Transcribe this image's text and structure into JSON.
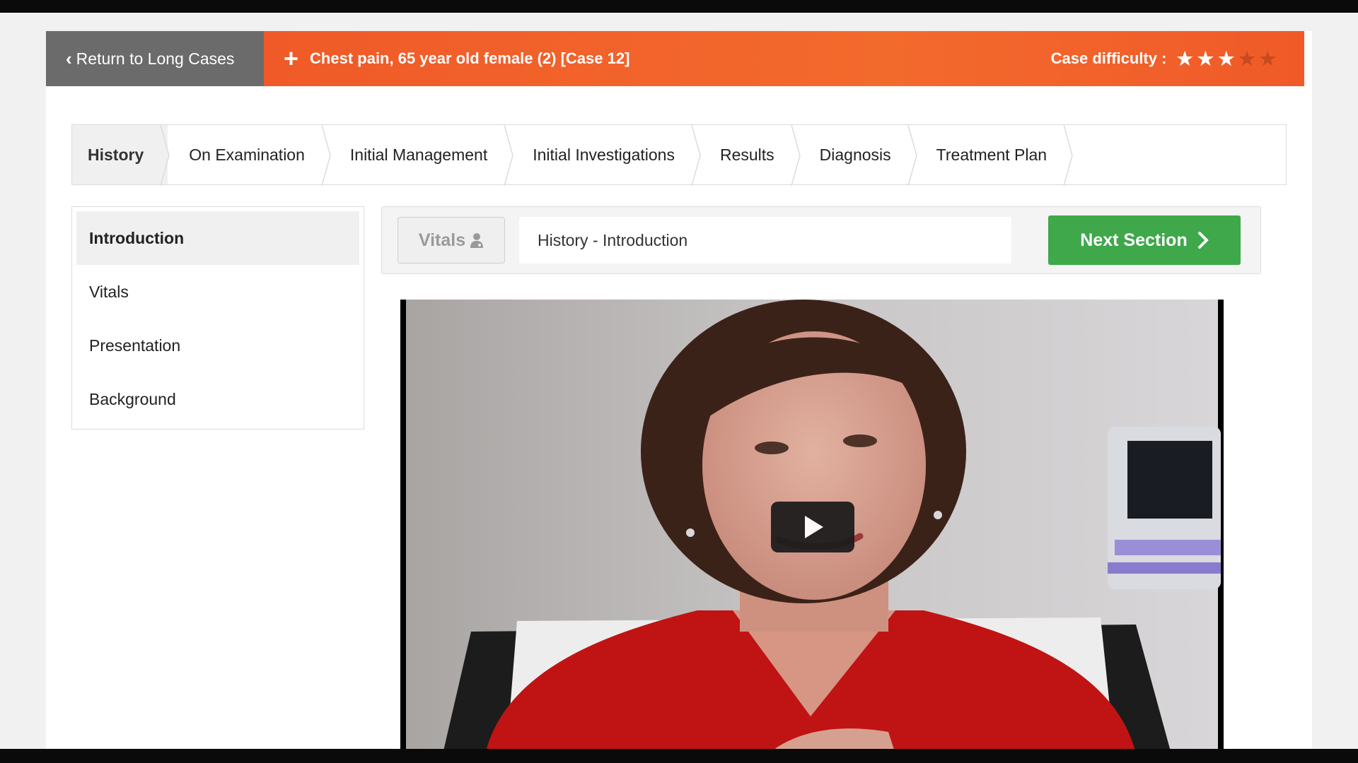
{
  "header": {
    "back_label": "Return to Long Cases",
    "case_title": "Chest pain, 65 year old female (2) [Case 12]",
    "difficulty_label": "Case difficulty :",
    "difficulty_rating": 3,
    "difficulty_max": 5
  },
  "tabs": [
    {
      "label": "History",
      "active": true
    },
    {
      "label": "On Examination",
      "active": false
    },
    {
      "label": "Initial Management",
      "active": false
    },
    {
      "label": "Initial Investigations",
      "active": false
    },
    {
      "label": "Results",
      "active": false
    },
    {
      "label": "Diagnosis",
      "active": false
    },
    {
      "label": "Treatment Plan",
      "active": false
    }
  ],
  "sidebar": {
    "items": [
      {
        "label": "Introduction",
        "active": true
      },
      {
        "label": "Vitals",
        "active": false
      },
      {
        "label": "Presentation",
        "active": false
      },
      {
        "label": "Background",
        "active": false
      }
    ]
  },
  "controls": {
    "vitals_label": "Vitals",
    "section_title": "History - Introduction",
    "next_label": "Next Section"
  },
  "colors": {
    "brand_orange": "#f05a28",
    "back_gray": "#6b6b6b",
    "next_green": "#3ea84a"
  },
  "icons": {
    "back": "chevron-left-icon",
    "case": "plus-icon",
    "star": "star-icon",
    "vitals": "doctor-icon",
    "next": "chevron-right-icon",
    "video": "play-icon"
  }
}
